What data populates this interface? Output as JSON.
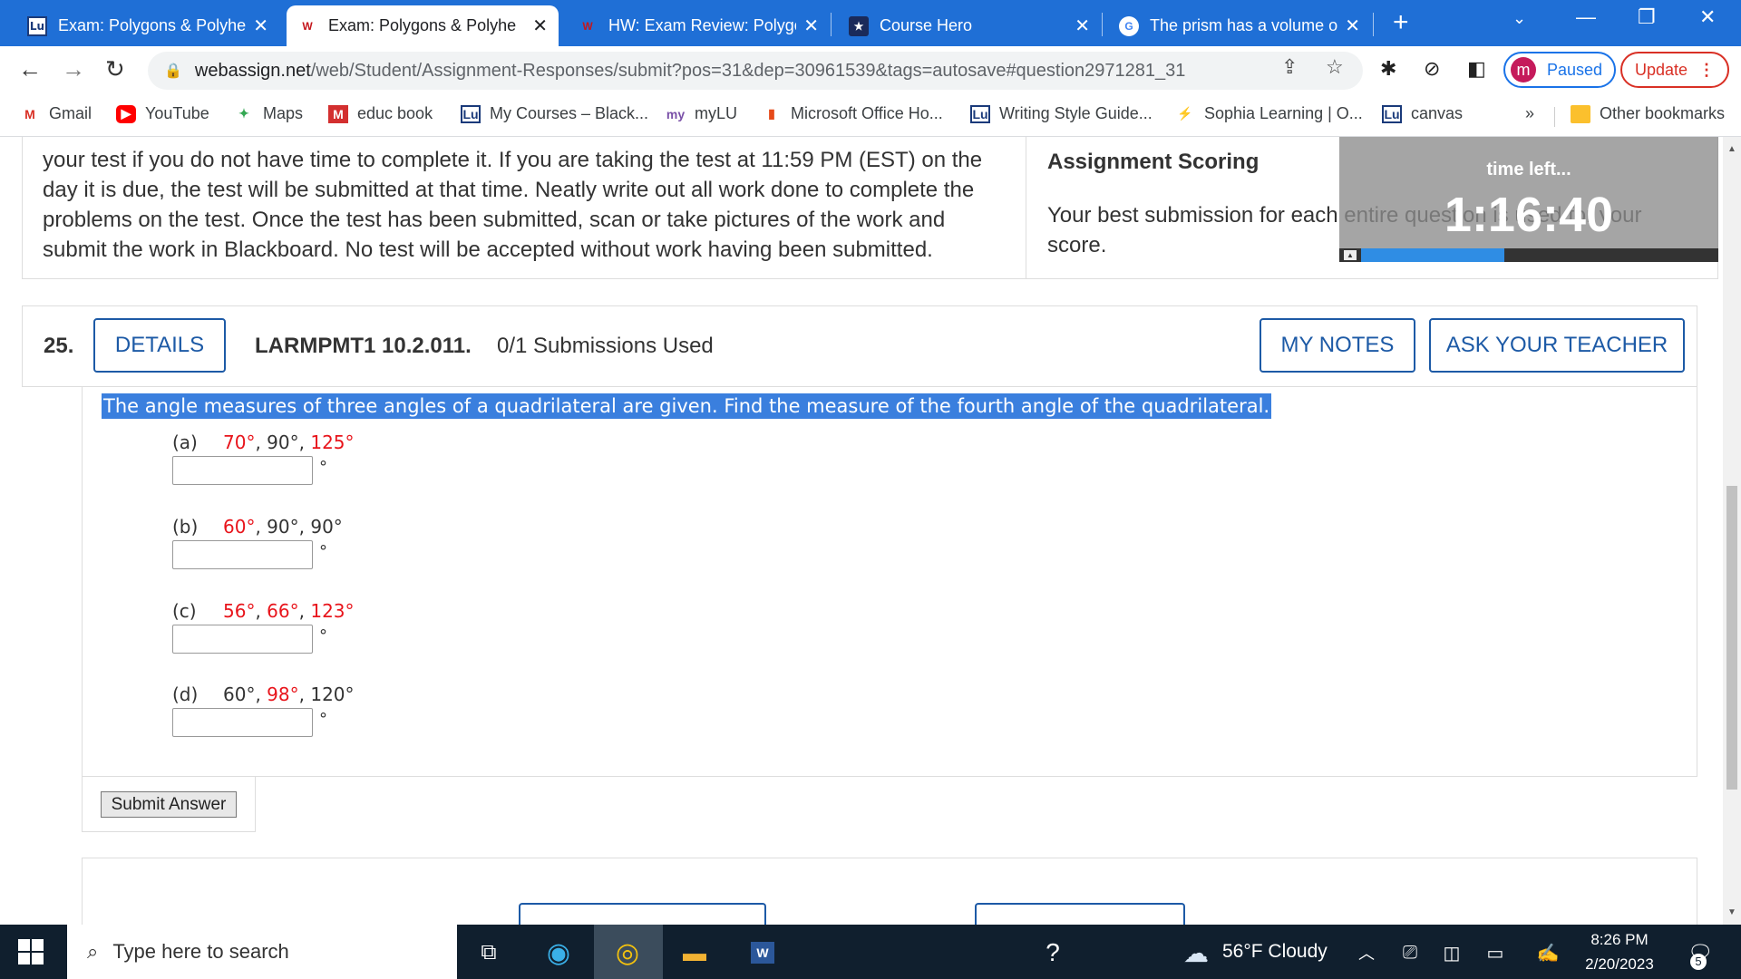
{
  "browser": {
    "tabs": [
      {
        "title": "Exam: Polygons & Polyhe",
        "favicon": "Lu",
        "active": false
      },
      {
        "title": "Exam: Polygons & Polyhe",
        "favicon": "WA",
        "active": true
      },
      {
        "title": "HW: Exam Review: Polygo",
        "favicon": "WA",
        "active": false
      },
      {
        "title": "Course Hero",
        "favicon": "★",
        "active": false
      },
      {
        "title": "The prism has a volume o",
        "favicon": "G",
        "active": false
      }
    ],
    "url_host": "webassign.net",
    "url_path": "/web/Student/Assignment-Responses/submit?pos=31&dep=30961539&tags=autosave#question2971281_31",
    "profile_initial": "m",
    "profile_status": "Paused",
    "update_label": "Update",
    "bookmarks": [
      {
        "label": "Gmail"
      },
      {
        "label": "YouTube"
      },
      {
        "label": "Maps"
      },
      {
        "label": "educ book"
      },
      {
        "label": "My Courses – Black..."
      },
      {
        "label": "myLU"
      },
      {
        "label": "Microsoft Office Ho..."
      },
      {
        "label": "Writing Style Guide..."
      },
      {
        "label": "Sophia Learning | O..."
      },
      {
        "label": "canvas"
      }
    ],
    "bookmarks_overflow": "»",
    "other_bookmarks": "Other bookmarks"
  },
  "page": {
    "instructions": "your test if you do not have time to complete it. If you are taking the test at 11:59 PM (EST) on the day it is due, the test will be submitted at that time. Neatly write out all work done to complete the problems on the test. Once the test has been submitted, scan or take pictures of the work and submit the work in Blackboard. No test will be accepted without work having been submitted.",
    "scoring_title": "Assignment Scoring",
    "scoring_text": "Your best submission for each entire question is used for your score.",
    "timer": {
      "label": "time left...",
      "value": "1:16:40",
      "progress": 0.4
    },
    "question": {
      "number": "25.",
      "details_label": "DETAILS",
      "code": "LARMPMT1 10.2.011.",
      "submissions": "0/1 Submissions Used",
      "my_notes_label": "MY NOTES",
      "ask_teacher_label": "ASK YOUR TEACHER",
      "prompt": "The angle measures of three angles of a quadrilateral are given. Find the measure of the fourth angle of the quadrilateral.",
      "parts": [
        {
          "label": "(a)",
          "a": "70°",
          "b": "90°",
          "c": "125°",
          "red": [
            true,
            false,
            true
          ],
          "answer": ""
        },
        {
          "label": "(b)",
          "a": "60°",
          "b": "90°",
          "c": "90°",
          "red": [
            true,
            false,
            false
          ],
          "answer": ""
        },
        {
          "label": "(c)",
          "a": "56°",
          "b": "66°",
          "c": "123°",
          "red": [
            true,
            true,
            true
          ],
          "answer": ""
        },
        {
          "label": "(d)",
          "a": "60°",
          "b": "98°",
          "c": "120°",
          "red": [
            false,
            true,
            false
          ],
          "answer": ""
        }
      ],
      "unit": "°",
      "submit_label": "Submit Answer"
    }
  },
  "taskbar": {
    "search_placeholder": "Type here to search",
    "weather": "56°F  Cloudy",
    "time": "8:26 PM",
    "date": "2/20/2023",
    "notifications": "5"
  }
}
